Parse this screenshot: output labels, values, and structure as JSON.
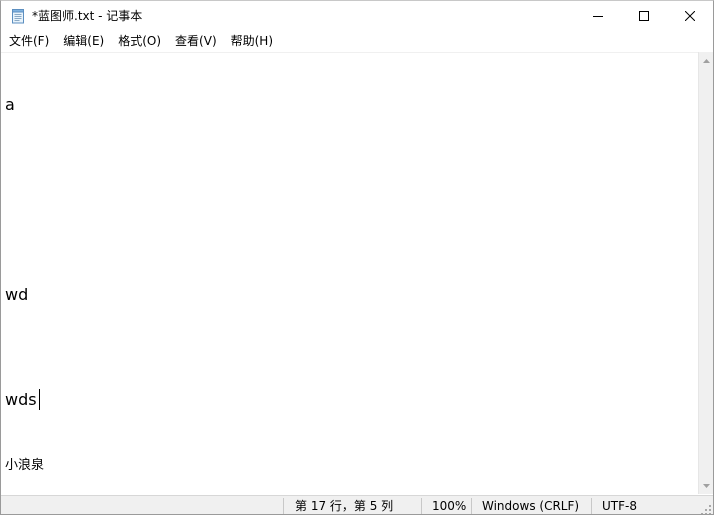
{
  "window": {
    "title": "*蓝图师.txt - 记事本",
    "icon": "notepad-icon"
  },
  "titlebar_buttons": {
    "minimize_icon": "minimize-icon",
    "maximize_icon": "maximize-icon",
    "close_icon": "close-icon"
  },
  "menu": {
    "items": [
      {
        "label": "文件(F)"
      },
      {
        "label": "编辑(E)"
      },
      {
        "label": "格式(O)"
      },
      {
        "label": "查看(V)"
      },
      {
        "label": "帮助(H)"
      }
    ]
  },
  "document": {
    "lines": [
      {
        "text": "a"
      },
      {
        "text": "wd"
      },
      {
        "text": "wds"
      },
      {
        "text": "小浪泉"
      }
    ]
  },
  "status": {
    "position": "第 17 行，第 5 列",
    "zoom": "100%",
    "line_ending": "Windows (CRLF)",
    "encoding": "UTF-8"
  },
  "colors": {
    "window_bg": "#ffffff",
    "statusbar_bg": "#f0f0f0",
    "text": "#000000"
  }
}
